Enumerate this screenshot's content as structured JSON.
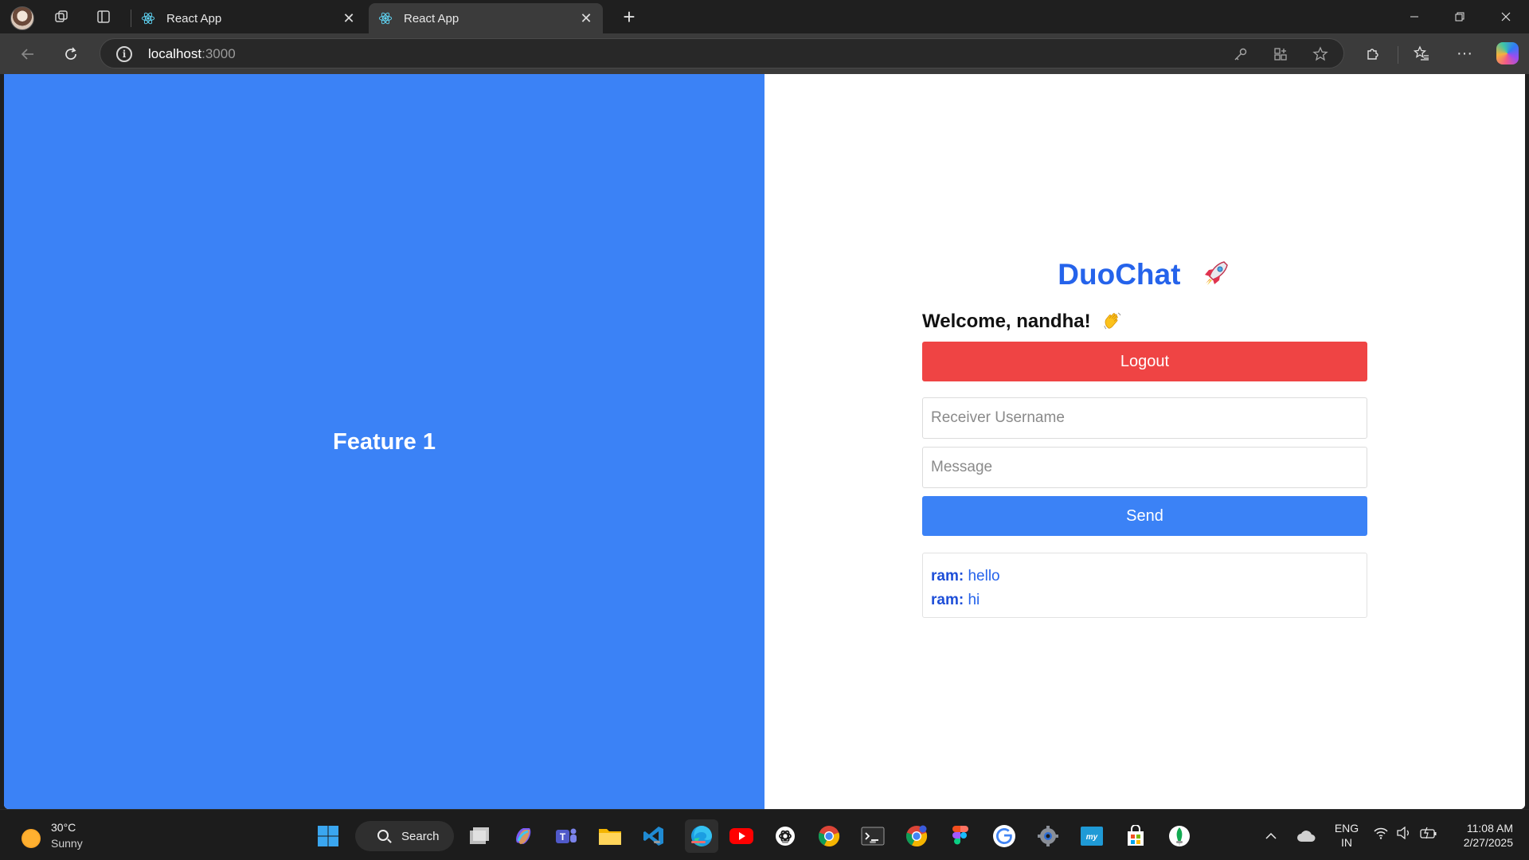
{
  "browser": {
    "tabs": [
      {
        "label": "React App",
        "active": false
      },
      {
        "label": "React App",
        "active": true
      }
    ],
    "url_host": "localhost",
    "url_port": ":3000",
    "new_tab_icon": "plus-icon"
  },
  "page": {
    "left_panel": {
      "feature_label": "Feature 1",
      "color": "#3b82f6"
    },
    "chat": {
      "brand": "DuoChat",
      "brand_icon": "rocket-icon",
      "welcome": "Welcome, nandha!",
      "welcome_icon": "waving-hand-icon",
      "logout_label": "Logout",
      "receiver_placeholder": "Receiver Username",
      "message_placeholder": "Message",
      "send_label": "Send",
      "messages": [
        {
          "sender": "ram:",
          "text": "hello"
        },
        {
          "sender": "ram:",
          "text": "hi"
        }
      ],
      "colors": {
        "brand": "#2563eb",
        "logout": "#ef4444",
        "send": "#3b82f6"
      }
    }
  },
  "taskbar": {
    "weather": {
      "temp": "30°C",
      "condition": "Sunny"
    },
    "search_label": "Search",
    "apps": [
      "start-icon",
      "task-view-icon",
      "copilot-icon",
      "teams-icon",
      "file-explorer-icon",
      "vscode-icon",
      "edge-icon",
      "youtube-icon",
      "chatgpt-icon",
      "chrome-icon",
      "terminal-icon",
      "chrome-profile-icon",
      "figma-icon",
      "google-icon",
      "settings-icon",
      "mysql-icon",
      "store-icon",
      "mongodb-icon"
    ],
    "language": {
      "line1": "ENG",
      "line2": "IN"
    },
    "clock": {
      "time": "11:08 AM",
      "date": "2/27/2025"
    }
  }
}
